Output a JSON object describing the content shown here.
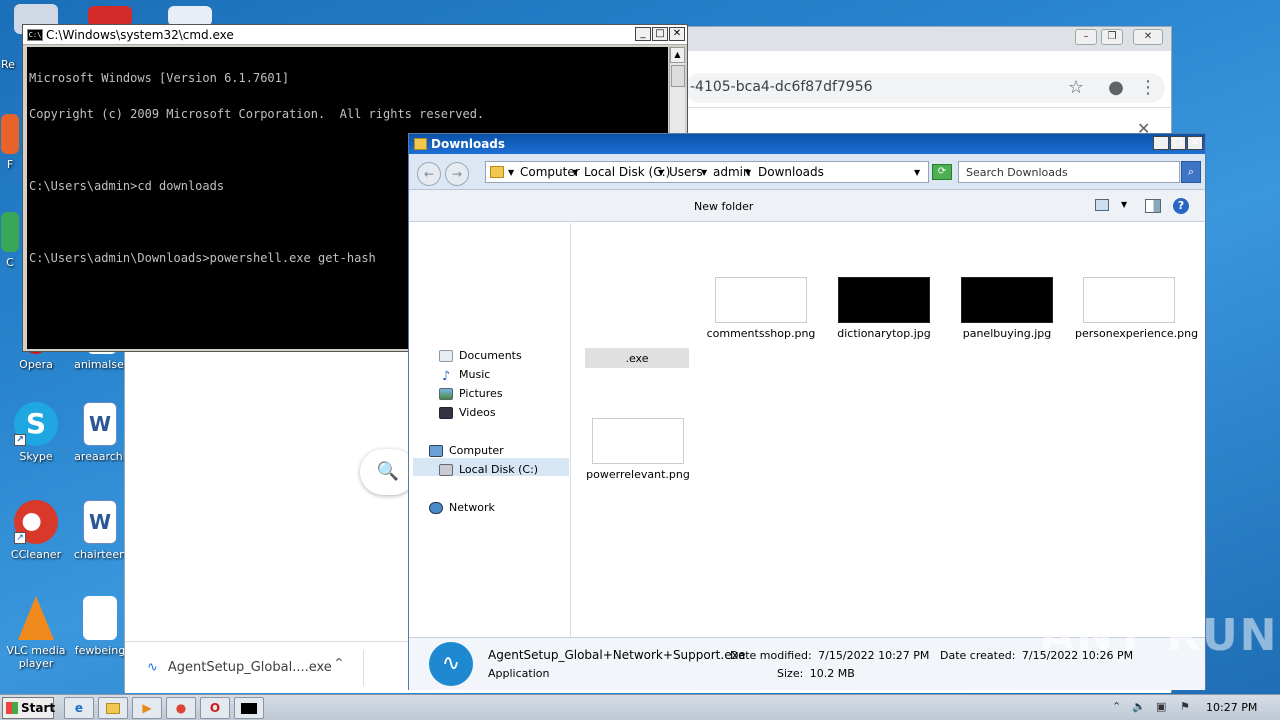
{
  "desktop": {
    "icons": [
      {
        "label": "Opera"
      },
      {
        "label": "animalsec"
      },
      {
        "label": "Skype"
      },
      {
        "label": "areaarchi"
      },
      {
        "label": "CCleaner"
      },
      {
        "label": "chairteen"
      },
      {
        "label": "VLC media player"
      },
      {
        "label": "fewbeing"
      }
    ],
    "partial_labels": [
      "Re",
      "F",
      "C"
    ]
  },
  "chrome": {
    "url": "-4105-bca4-dc6f87df7956",
    "download": {
      "filename": "AgentSetup_Global....exe"
    }
  },
  "cmd": {
    "title": "C:\\Windows\\system32\\cmd.exe",
    "lines": [
      "Microsoft Windows [Version 6.1.7601]",
      "Copyright (c) 2009 Microsoft Corporation.  All rights reserved.",
      "",
      "C:\\Users\\admin>cd downloads",
      "",
      "C:\\Users\\admin\\Downloads>powershell.exe get-hash"
    ]
  },
  "explorer": {
    "title": "Downloads",
    "breadcrumb": [
      "Computer",
      "Local Disk (C:)",
      "Users",
      "admin",
      "Downloads"
    ],
    "search_placeholder": "Search Downloads",
    "toolbar": {
      "new_folder": "New folder"
    },
    "nav": {
      "documents": "Documents",
      "music": "Music",
      "pictures": "Pictures",
      "videos": "Videos",
      "computer": "Computer",
      "local_disk": "Local Disk (C:)",
      "network": "Network"
    },
    "files": [
      {
        "name": ".exe"
      },
      {
        "name": "commentsshop.png"
      },
      {
        "name": "dictionarytop.jpg"
      },
      {
        "name": "panelbuying.jpg"
      },
      {
        "name": "personexperience.png"
      },
      {
        "name": "powerrelevant.png"
      }
    ],
    "details": {
      "filename": "AgentSetup_Global+Network+Support.exe",
      "type": "Application",
      "date_modified_label": "Date modified:",
      "date_modified": "7/15/2022 10:27 PM",
      "date_created_label": "Date created:",
      "date_created": "7/15/2022 10:26 PM",
      "size_label": "Size:",
      "size": "10.2 MB"
    }
  },
  "taskbar": {
    "start_label": "Start",
    "clock": "10:27 PM"
  },
  "watermark": "ANY RUN",
  "colors": {
    "desktop": "#2a86cf",
    "explorer_title": "#1d6fd4"
  }
}
